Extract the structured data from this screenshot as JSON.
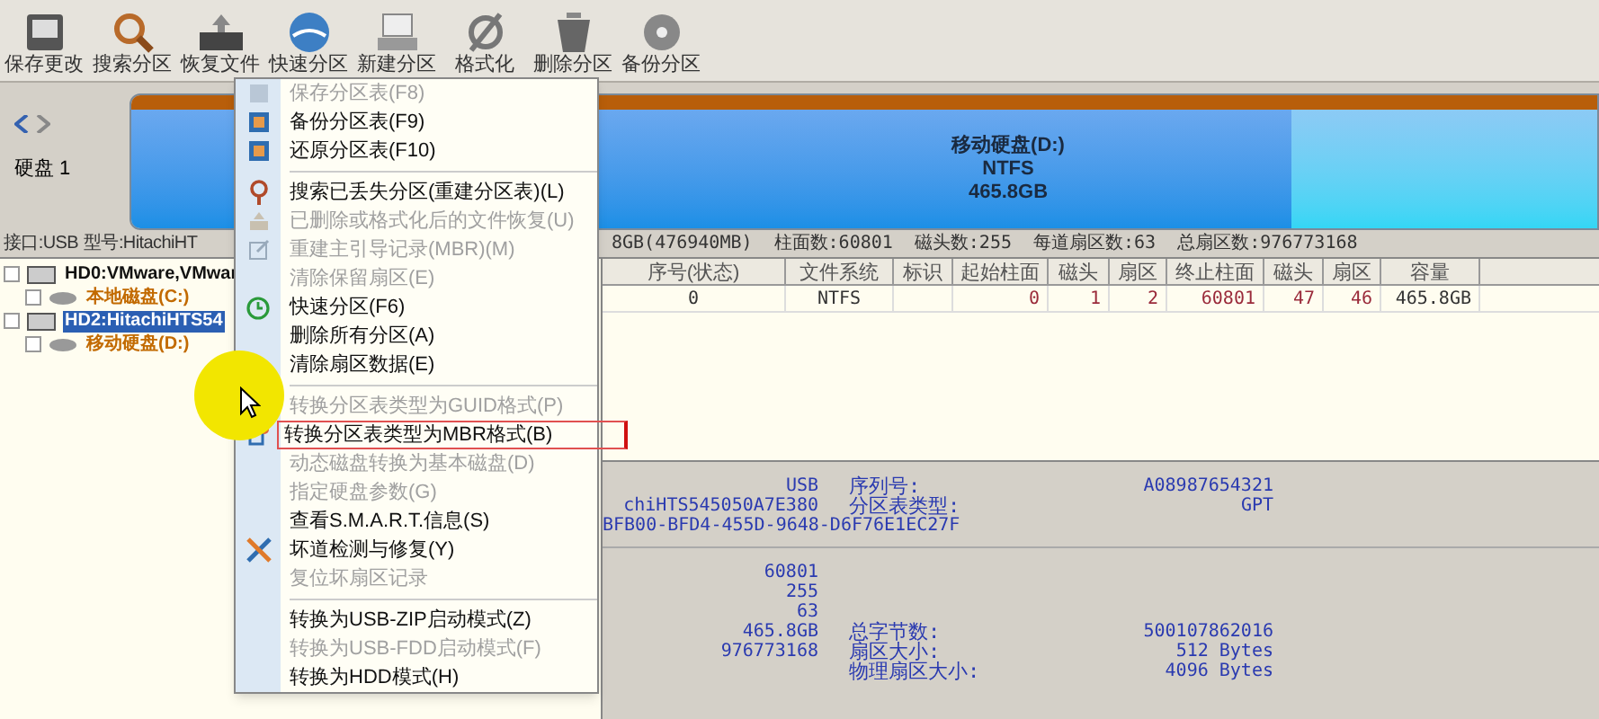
{
  "toolbar": [
    {
      "label": "保存更改"
    },
    {
      "label": "搜索分区"
    },
    {
      "label": "恢复文件"
    },
    {
      "label": "快速分区"
    },
    {
      "label": "新建分区"
    },
    {
      "label": "格式化"
    },
    {
      "label": "删除分区"
    },
    {
      "label": "备份分区"
    }
  ],
  "disk_nav": {
    "label": "硬盘 1"
  },
  "disk_bar": {
    "name": "移动硬盘(D:)",
    "filesystem": "NTFS",
    "size": "465.8GB"
  },
  "disk_info": {
    "left": [
      "接口:USB",
      "型号:HitachiHT"
    ],
    "right": [
      "8GB(476940MB)",
      "柱面数:60801",
      "磁头数:255",
      "每道扇区数:63",
      "总扇区数:976773168"
    ]
  },
  "tree": [
    {
      "label": "HD0:VMware,VMwar",
      "selected": false,
      "children": [
        {
          "label": "本地磁盘(C:)",
          "selected": false
        }
      ]
    },
    {
      "label": "HD2:HitachiHTS54",
      "selected": true,
      "children": [
        {
          "label": "移动硬盘(D:)",
          "selected": false
        }
      ]
    }
  ],
  "table": {
    "columns": [
      "序号(状态)",
      "文件系统",
      "标识",
      "起始柱面",
      "磁头",
      "扇区",
      "终止柱面",
      "磁头",
      "扇区",
      "容量"
    ],
    "rows": [
      [
        "0",
        "NTFS",
        "",
        "0",
        "1",
        "2",
        "60801",
        "47",
        "46",
        "465.8GB"
      ]
    ]
  },
  "details": {
    "left_values": [
      "USB",
      "chiHTS545050A7E380"
    ],
    "guid": "BFB00-BFD4-455D-9648-D6F76E1EC27F",
    "top_pairs": [
      {
        "label": "序列号:",
        "value": "A08987654321"
      },
      {
        "label": "分区表类型:",
        "value": "GPT"
      }
    ],
    "lower_values": [
      "60801",
      "255",
      "63",
      "465.8GB",
      "976773168"
    ],
    "lower_pairs": [
      {
        "label": "总字节数:",
        "value": "500107862016"
      },
      {
        "label": "扇区大小:",
        "value": "512 Bytes"
      },
      {
        "label": "物理扇区大小:",
        "value": "4096 Bytes"
      }
    ]
  },
  "context_menu": [
    {
      "kind": "item",
      "label": "保存分区表(F8)",
      "disabled": true,
      "highlighted": false
    },
    {
      "kind": "item",
      "label": "备份分区表(F9)",
      "disabled": false,
      "highlighted": false
    },
    {
      "kind": "item",
      "label": "还原分区表(F10)",
      "disabled": false,
      "highlighted": false
    },
    {
      "kind": "separator"
    },
    {
      "kind": "item",
      "label": "搜索已丢失分区(重建分区表)(L)",
      "disabled": false,
      "highlighted": false
    },
    {
      "kind": "item",
      "label": "已删除或格式化后的文件恢复(U)",
      "disabled": true,
      "highlighted": false
    },
    {
      "kind": "item",
      "label": "重建主引导记录(MBR)(M)",
      "disabled": true,
      "highlighted": false
    },
    {
      "kind": "item",
      "label": "清除保留扇区(E)",
      "disabled": true,
      "highlighted": false
    },
    {
      "kind": "item",
      "label": "快速分区(F6)",
      "disabled": false,
      "highlighted": false
    },
    {
      "kind": "item",
      "label": "删除所有分区(A)",
      "disabled": false,
      "highlighted": false
    },
    {
      "kind": "item",
      "label": "清除扇区数据(E)",
      "disabled": false,
      "highlighted": false
    },
    {
      "kind": "separator"
    },
    {
      "kind": "item",
      "label": "转换分区表类型为GUID格式(P)",
      "disabled": true,
      "highlighted": false
    },
    {
      "kind": "item",
      "label": "转换分区表类型为MBR格式(B)",
      "disabled": false,
      "highlighted": true
    },
    {
      "kind": "item",
      "label": "动态磁盘转换为基本磁盘(D)",
      "disabled": true,
      "highlighted": false
    },
    {
      "kind": "item",
      "label": "指定硬盘参数(G)",
      "disabled": true,
      "highlighted": false
    },
    {
      "kind": "item",
      "label": "查看S.M.A.R.T.信息(S)",
      "disabled": false,
      "highlighted": false
    },
    {
      "kind": "item",
      "label": "坏道检测与修复(Y)",
      "disabled": false,
      "highlighted": false
    },
    {
      "kind": "item",
      "label": "复位坏扇区记录",
      "disabled": true,
      "highlighted": false
    },
    {
      "kind": "separator"
    },
    {
      "kind": "item",
      "label": "转换为USB-ZIP启动模式(Z)",
      "disabled": false,
      "highlighted": false
    },
    {
      "kind": "item",
      "label": "转换为USB-FDD启动模式(F)",
      "disabled": true,
      "highlighted": false
    },
    {
      "kind": "item",
      "label": "转换为HDD模式(H)",
      "disabled": false,
      "highlighted": false
    }
  ]
}
